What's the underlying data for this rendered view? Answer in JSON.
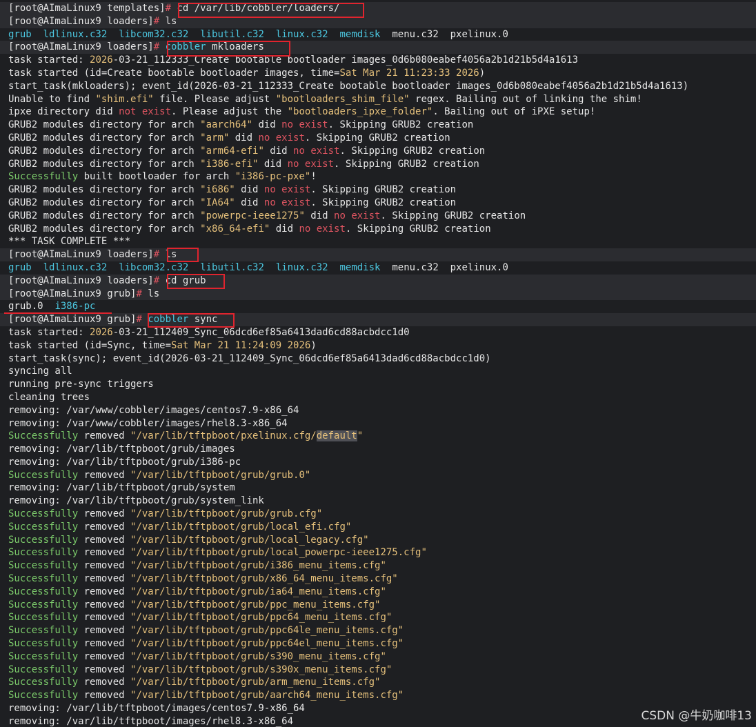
{
  "colors": {
    "background": "#1e1f22",
    "text": "#e6e6e6",
    "prompt_symbol": "#e05561",
    "directory_listing": "#4cc7e0",
    "string_literal": "#e5c07b",
    "success_keyword": "#7ccb6b",
    "error_keyword": "#e05561",
    "annotation_box": "#e0242e"
  },
  "terminal": {
    "lines": [
      {
        "prompt": true,
        "segments": [
          [
            "[root@AImaLinux9 templates]",
            "white"
          ],
          [
            "# ",
            "red"
          ],
          [
            "cd /var/lib/cobbler/loaders/",
            "white"
          ]
        ]
      },
      {
        "prompt": true,
        "segments": [
          [
            "[root@AImaLinux9 loaders]",
            "white"
          ],
          [
            "# ",
            "red"
          ],
          [
            "ls",
            "white"
          ]
        ]
      },
      {
        "segments": [
          [
            "grub",
            "cyan"
          ],
          [
            "  ",
            "white"
          ],
          [
            "ldlinux.c32",
            "cyan"
          ],
          [
            "  ",
            "white"
          ],
          [
            "libcom32.c32",
            "cyan"
          ],
          [
            "  ",
            "white"
          ],
          [
            "libutil.c32",
            "cyan"
          ],
          [
            "  ",
            "white"
          ],
          [
            "linux.c32",
            "cyan"
          ],
          [
            "  ",
            "white"
          ],
          [
            "memdisk",
            "cyan"
          ],
          [
            "  menu.c32  pxelinux.0",
            "white"
          ]
        ]
      },
      {
        "prompt": true,
        "segments": [
          [
            "[root@AImaLinux9 loaders]",
            "white"
          ],
          [
            "# ",
            "red"
          ],
          [
            "cobbler",
            "cyan"
          ],
          [
            " mkloaders",
            "white"
          ]
        ]
      },
      {
        "segments": [
          [
            "task started: ",
            "white"
          ],
          [
            "2026",
            "yellow"
          ],
          [
            "-03-21_112333_Create bootable bootloader images_0d6b080eabef4056a2b1d21b5d4a1613",
            "white"
          ]
        ]
      },
      {
        "segments": [
          [
            "task started (id=Create bootable bootloader images, time=",
            "white"
          ],
          [
            "Sat Mar 21 11:23:33 2026",
            "yellow"
          ],
          [
            ")",
            "white"
          ]
        ]
      },
      {
        "segments": [
          [
            "start_task(mkloaders); event_id(2026-03-21_112333_Create bootable bootloader images_0d6b080eabef4056a2b1d21b5d4a1613)",
            "white"
          ]
        ]
      },
      {
        "segments": [
          [
            "Unable to find ",
            "white"
          ],
          [
            "\"shim.efi\"",
            "yellow"
          ],
          [
            " file. Please adjust ",
            "white"
          ],
          [
            "\"bootloaders_shim_file\"",
            "yellow"
          ],
          [
            " regex. Bailing out of linking the shim!",
            "white"
          ]
        ]
      },
      {
        "segments": [
          [
            "ipxe directory did ",
            "white"
          ],
          [
            "not exist",
            "red"
          ],
          [
            ". Please adjust the ",
            "white"
          ],
          [
            "\"bootloaders_ipxe_folder\"",
            "yellow"
          ],
          [
            ". Bailing out of iPXE setup!",
            "white"
          ]
        ]
      },
      {
        "segments": [
          [
            "GRUB2 modules directory for arch ",
            "white"
          ],
          [
            "\"aarch64\"",
            "yellow"
          ],
          [
            " did ",
            "white"
          ],
          [
            "no exist",
            "red"
          ],
          [
            ". Skipping GRUB2 creation",
            "white"
          ]
        ]
      },
      {
        "segments": [
          [
            "GRUB2 modules directory for arch ",
            "white"
          ],
          [
            "\"arm\"",
            "yellow"
          ],
          [
            " did ",
            "white"
          ],
          [
            "no exist",
            "red"
          ],
          [
            ". Skipping GRUB2 creation",
            "white"
          ]
        ]
      },
      {
        "segments": [
          [
            "GRUB2 modules directory for arch ",
            "white"
          ],
          [
            "\"arm64-efi\"",
            "yellow"
          ],
          [
            " did ",
            "white"
          ],
          [
            "no exist",
            "red"
          ],
          [
            ". Skipping GRUB2 creation",
            "white"
          ]
        ]
      },
      {
        "segments": [
          [
            "GRUB2 modules directory for arch ",
            "white"
          ],
          [
            "\"i386-efi\"",
            "yellow"
          ],
          [
            " did ",
            "white"
          ],
          [
            "no exist",
            "red"
          ],
          [
            ". Skipping GRUB2 creation",
            "white"
          ]
        ]
      },
      {
        "segments": [
          [
            "Successfully",
            "green"
          ],
          [
            " built bootloader for arch ",
            "white"
          ],
          [
            "\"i386-pc-pxe\"",
            "yellow"
          ],
          [
            "!",
            "white"
          ]
        ]
      },
      {
        "segments": [
          [
            "GRUB2 modules directory for arch ",
            "white"
          ],
          [
            "\"i686\"",
            "yellow"
          ],
          [
            " did ",
            "white"
          ],
          [
            "no exist",
            "red"
          ],
          [
            ". Skipping GRUB2 creation",
            "white"
          ]
        ]
      },
      {
        "segments": [
          [
            "GRUB2 modules directory for arch ",
            "white"
          ],
          [
            "\"IA64\"",
            "yellow"
          ],
          [
            " did ",
            "white"
          ],
          [
            "no exist",
            "red"
          ],
          [
            ". Skipping GRUB2 creation",
            "white"
          ]
        ]
      },
      {
        "segments": [
          [
            "GRUB2 modules directory for arch ",
            "white"
          ],
          [
            "\"powerpc-ieee1275\"",
            "yellow"
          ],
          [
            " did ",
            "white"
          ],
          [
            "no exist",
            "red"
          ],
          [
            ". Skipping GRUB2 creation",
            "white"
          ]
        ]
      },
      {
        "segments": [
          [
            "GRUB2 modules directory for arch ",
            "white"
          ],
          [
            "\"x86_64-efi\"",
            "yellow"
          ],
          [
            " did ",
            "white"
          ],
          [
            "no exist",
            "red"
          ],
          [
            ". Skipping GRUB2 creation",
            "white"
          ]
        ]
      },
      {
        "segments": [
          [
            "*** TASK COMPLETE ***",
            "white"
          ]
        ]
      },
      {
        "prompt": true,
        "segments": [
          [
            "[root@AImaLinux9 loaders]",
            "white"
          ],
          [
            "# ",
            "red"
          ],
          [
            "ls",
            "white"
          ]
        ]
      },
      {
        "segments": [
          [
            "grub",
            "cyan"
          ],
          [
            "  ",
            "white"
          ],
          [
            "ldlinux.c32",
            "cyan"
          ],
          [
            "  ",
            "white"
          ],
          [
            "libcom32.c32",
            "cyan"
          ],
          [
            "  ",
            "white"
          ],
          [
            "libutil.c32",
            "cyan"
          ],
          [
            "  ",
            "white"
          ],
          [
            "linux.c32",
            "cyan"
          ],
          [
            "  ",
            "white"
          ],
          [
            "memdisk",
            "cyan"
          ],
          [
            "  menu.c32  pxelinux.0",
            "white"
          ]
        ]
      },
      {
        "prompt": true,
        "segments": [
          [
            "[root@AImaLinux9 loaders]",
            "white"
          ],
          [
            "# ",
            "red"
          ],
          [
            "cd grub",
            "white"
          ]
        ]
      },
      {
        "prompt": true,
        "segments": [
          [
            "[root@AImaLinux9 grub]",
            "white"
          ],
          [
            "# ",
            "red"
          ],
          [
            "ls",
            "white"
          ]
        ]
      },
      {
        "segments": [
          [
            "grub.0  ",
            "white"
          ],
          [
            "i386-pc",
            "cyan"
          ]
        ]
      },
      {
        "prompt": true,
        "segments": [
          [
            "[root@AImaLinux9 grub]",
            "white"
          ],
          [
            "# ",
            "red"
          ],
          [
            "cobbler",
            "cyan"
          ],
          [
            " sync",
            "white"
          ]
        ]
      },
      {
        "segments": [
          [
            "task started: ",
            "white"
          ],
          [
            "2026",
            "yellow"
          ],
          [
            "-03-21_112409_Sync_06dcd6ef85a6413dad6cd88acbdcc1d0",
            "white"
          ]
        ]
      },
      {
        "segments": [
          [
            "task started (id=Sync, time=",
            "white"
          ],
          [
            "Sat Mar 21 11:24:09 2026",
            "yellow"
          ],
          [
            ")",
            "white"
          ]
        ]
      },
      {
        "segments": [
          [
            "start_task(sync); event_id(2026-03-21_112409_Sync_06dcd6ef85a6413dad6cd88acbdcc1d0)",
            "white"
          ]
        ]
      },
      {
        "segments": [
          [
            "syncing all",
            "white"
          ]
        ]
      },
      {
        "segments": [
          [
            "running pre-sync triggers",
            "white"
          ]
        ]
      },
      {
        "segments": [
          [
            "cleaning trees",
            "white"
          ]
        ]
      },
      {
        "segments": [
          [
            "removing: /var/www/cobbler/images/centos7.9-x86_64",
            "white"
          ]
        ]
      },
      {
        "segments": [
          [
            "removing: /var/www/cobbler/images/rhel8.3-x86_64",
            "white"
          ]
        ]
      },
      {
        "segments": [
          [
            "Successfully",
            "green"
          ],
          [
            " removed ",
            "white"
          ],
          [
            "\"/var/lib/tftpboot/pxelinux.cfg/",
            "yellow"
          ],
          [
            "default",
            "hl"
          ],
          [
            "\"",
            "yellow"
          ]
        ]
      },
      {
        "segments": [
          [
            "removing: /var/lib/tftpboot/grub/images",
            "white"
          ]
        ]
      },
      {
        "segments": [
          [
            "removing: /var/lib/tftpboot/grub/i386-pc",
            "white"
          ]
        ]
      },
      {
        "segments": [
          [
            "Successfully",
            "green"
          ],
          [
            " removed ",
            "white"
          ],
          [
            "\"/var/lib/tftpboot/grub/grub.0\"",
            "yellow"
          ]
        ]
      },
      {
        "segments": [
          [
            "removing: /var/lib/tftpboot/grub/system",
            "white"
          ]
        ]
      },
      {
        "segments": [
          [
            "removing: /var/lib/tftpboot/grub/system_link",
            "white"
          ]
        ]
      },
      {
        "segments": [
          [
            "Successfully",
            "green"
          ],
          [
            " removed ",
            "white"
          ],
          [
            "\"/var/lib/tftpboot/grub/grub.cfg\"",
            "yellow"
          ]
        ]
      },
      {
        "segments": [
          [
            "Successfully",
            "green"
          ],
          [
            " removed ",
            "white"
          ],
          [
            "\"/var/lib/tftpboot/grub/local_efi.cfg\"",
            "yellow"
          ]
        ]
      },
      {
        "segments": [
          [
            "Successfully",
            "green"
          ],
          [
            " removed ",
            "white"
          ],
          [
            "\"/var/lib/tftpboot/grub/local_legacy.cfg\"",
            "yellow"
          ]
        ]
      },
      {
        "segments": [
          [
            "Successfully",
            "green"
          ],
          [
            " removed ",
            "white"
          ],
          [
            "\"/var/lib/tftpboot/grub/local_powerpc-ieee1275.cfg\"",
            "yellow"
          ]
        ]
      },
      {
        "segments": [
          [
            "Successfully",
            "green"
          ],
          [
            " removed ",
            "white"
          ],
          [
            "\"/var/lib/tftpboot/grub/i386_menu_items.cfg\"",
            "yellow"
          ]
        ]
      },
      {
        "segments": [
          [
            "Successfully",
            "green"
          ],
          [
            " removed ",
            "white"
          ],
          [
            "\"/var/lib/tftpboot/grub/x86_64_menu_items.cfg\"",
            "yellow"
          ]
        ]
      },
      {
        "segments": [
          [
            "Successfully",
            "green"
          ],
          [
            " removed ",
            "white"
          ],
          [
            "\"/var/lib/tftpboot/grub/ia64_menu_items.cfg\"",
            "yellow"
          ]
        ]
      },
      {
        "segments": [
          [
            "Successfully",
            "green"
          ],
          [
            " removed ",
            "white"
          ],
          [
            "\"/var/lib/tftpboot/grub/ppc_menu_items.cfg\"",
            "yellow"
          ]
        ]
      },
      {
        "segments": [
          [
            "Successfully",
            "green"
          ],
          [
            " removed ",
            "white"
          ],
          [
            "\"/var/lib/tftpboot/grub/ppc64_menu_items.cfg\"",
            "yellow"
          ]
        ]
      },
      {
        "segments": [
          [
            "Successfully",
            "green"
          ],
          [
            " removed ",
            "white"
          ],
          [
            "\"/var/lib/tftpboot/grub/ppc64le_menu_items.cfg\"",
            "yellow"
          ]
        ]
      },
      {
        "segments": [
          [
            "Successfully",
            "green"
          ],
          [
            " removed ",
            "white"
          ],
          [
            "\"/var/lib/tftpboot/grub/ppc64el_menu_items.cfg\"",
            "yellow"
          ]
        ]
      },
      {
        "segments": [
          [
            "Successfully",
            "green"
          ],
          [
            " removed ",
            "white"
          ],
          [
            "\"/var/lib/tftpboot/grub/s390_menu_items.cfg\"",
            "yellow"
          ]
        ]
      },
      {
        "segments": [
          [
            "Successfully",
            "green"
          ],
          [
            " removed ",
            "white"
          ],
          [
            "\"/var/lib/tftpboot/grub/s390x_menu_items.cfg\"",
            "yellow"
          ]
        ]
      },
      {
        "segments": [
          [
            "Successfully",
            "green"
          ],
          [
            " removed ",
            "white"
          ],
          [
            "\"/var/lib/tftpboot/grub/arm_menu_items.cfg\"",
            "yellow"
          ]
        ]
      },
      {
        "segments": [
          [
            "Successfully",
            "green"
          ],
          [
            " removed ",
            "white"
          ],
          [
            "\"/var/lib/tftpboot/grub/aarch64_menu_items.cfg\"",
            "yellow"
          ]
        ]
      },
      {
        "segments": [
          [
            "removing: /var/lib/tftpboot/images/centos7.9-x86_64",
            "white"
          ]
        ]
      },
      {
        "segments": [
          [
            "removing: /var/lib/tftpboot/images/rhel8.3-x86_64",
            "white"
          ]
        ]
      }
    ]
  },
  "watermark": "CSDN @牛奶咖啡13"
}
